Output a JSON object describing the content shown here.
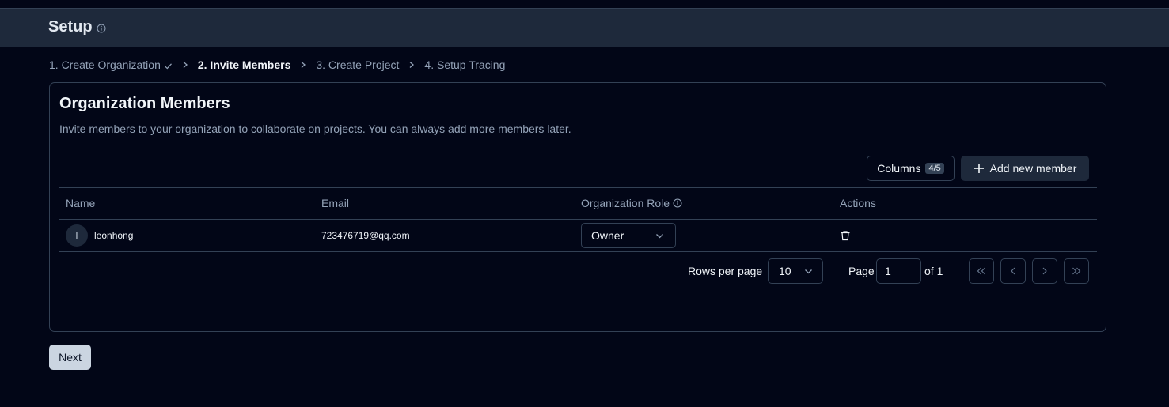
{
  "header": {
    "title": "Setup",
    "info_icon": "info-icon"
  },
  "steps": [
    {
      "label": "1. Create Organization",
      "done": true
    },
    {
      "label": "2. Invite Members",
      "active": true
    },
    {
      "label": "3. Create Project"
    },
    {
      "label": "4. Setup Tracing"
    }
  ],
  "card": {
    "title": "Organization Members",
    "description": "Invite members to your organization to collaborate on projects. You can always add more members later."
  },
  "toolbar": {
    "columns_label": "Columns",
    "columns_badge": "4/5",
    "add_label": "Add new member"
  },
  "table": {
    "headers": {
      "name": "Name",
      "email": "Email",
      "role": "Organization Role",
      "actions": "Actions"
    },
    "rows": [
      {
        "initial": "l",
        "name": "leonhong",
        "email": "723476719@qq.com",
        "role": "Owner"
      }
    ]
  },
  "pagination": {
    "rows_per_page_label": "Rows per page",
    "rows_per_page": "10",
    "page_label": "Page",
    "page_value": "1",
    "of_label": "of 1"
  },
  "footer": {
    "next_label": "Next"
  },
  "colors": {
    "background": "#020617",
    "header": "#1e293b",
    "border": "#334155",
    "primary_button": "#cbd5e1"
  }
}
